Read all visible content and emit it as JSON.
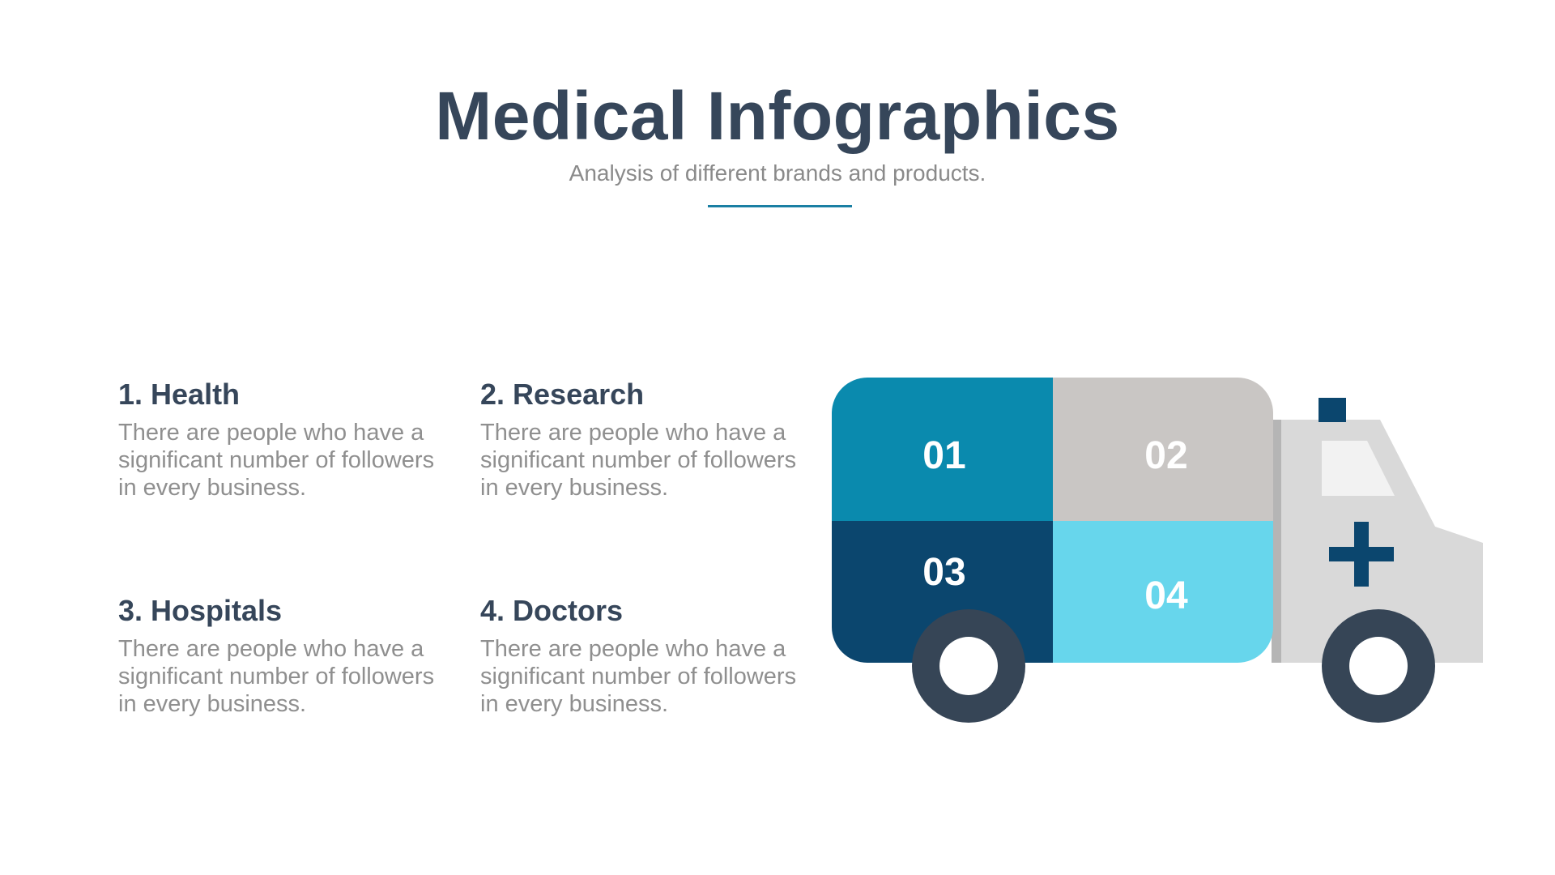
{
  "header": {
    "title": "Medical Infographics",
    "subtitle": "Analysis of different brands and products."
  },
  "items": [
    {
      "heading": "1. Health",
      "body": "There are people who have a significant number of followers in every business."
    },
    {
      "heading": "2. Research",
      "body": "There are people who have a significant number of followers in every business."
    },
    {
      "heading": "3. Hospitals",
      "body": "There are people who have a significant number of followers in every business."
    },
    {
      "heading": "4. Doctors",
      "body": "There are people who have a significant number of followers in every business."
    }
  ],
  "ambulance": {
    "blocks": [
      {
        "label": "01",
        "color": "#0a8aae"
      },
      {
        "label": "02",
        "color": "#c9c6c4"
      },
      {
        "label": "03",
        "color": "#0b466e"
      },
      {
        "label": "04",
        "color": "#67d6ec"
      }
    ],
    "colors": {
      "cab": "#d9d9d9",
      "window": "#f2f2f2",
      "cross": "#0b466e",
      "siren": "#0b466e",
      "wheel": "#364556",
      "accent_rule": "#1a7fa3"
    },
    "icons": [
      "ambulance-icon",
      "medical-cross-icon",
      "siren-light-icon"
    ]
  }
}
